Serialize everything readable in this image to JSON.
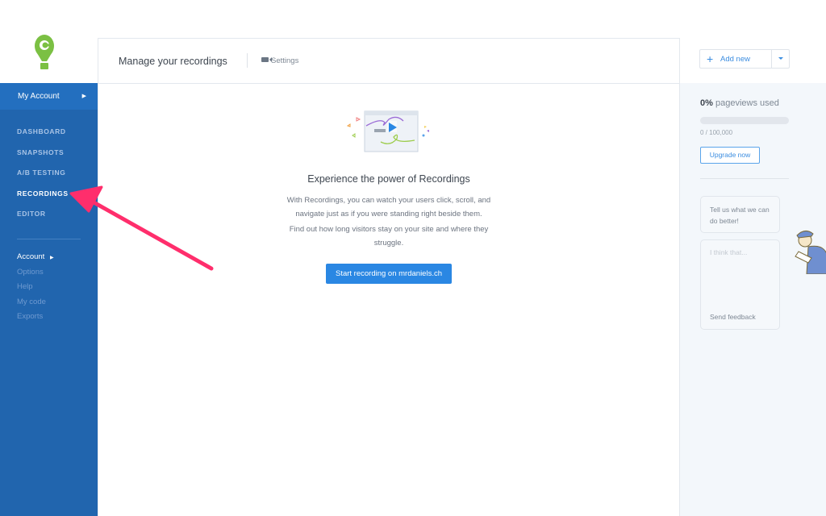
{
  "header": {
    "title": "Manage your recordings",
    "settings_label": "Settings"
  },
  "sidebar": {
    "my_account": "My Account",
    "nav": [
      {
        "label": "DASHBOARD"
      },
      {
        "label": "SNAPSHOTS"
      },
      {
        "label": "A/B TESTING"
      },
      {
        "label": "RECORDINGS",
        "active": true
      },
      {
        "label": "EDITOR"
      }
    ],
    "account": "Account",
    "sub": [
      "Options",
      "Help",
      "My code",
      "Exports"
    ]
  },
  "empty_state": {
    "title": "Experience the power of Recordings",
    "p1": "With Recordings, you can watch your users click, scroll, and navigate just as if you were standing right beside them.",
    "p2": "Find out how long visitors stay on your site and where they struggle.",
    "button": "Start recording on mrdaniels.ch"
  },
  "right": {
    "add_new": "Add new",
    "pageviews_percent": "0%",
    "pageviews_label": "pageviews used",
    "usage_fraction": 0,
    "count": "0 / 100,000",
    "upgrade": "Upgrade now",
    "feedback_prompt": "Tell us what we can do better!",
    "feedback_placeholder": "I think that...",
    "send_feedback": "Send feedback"
  },
  "colors": {
    "sidebar": "#2165ae",
    "accent": "#2a87e3",
    "logo": "#7bc043",
    "arrow": "#ff2e6c"
  }
}
